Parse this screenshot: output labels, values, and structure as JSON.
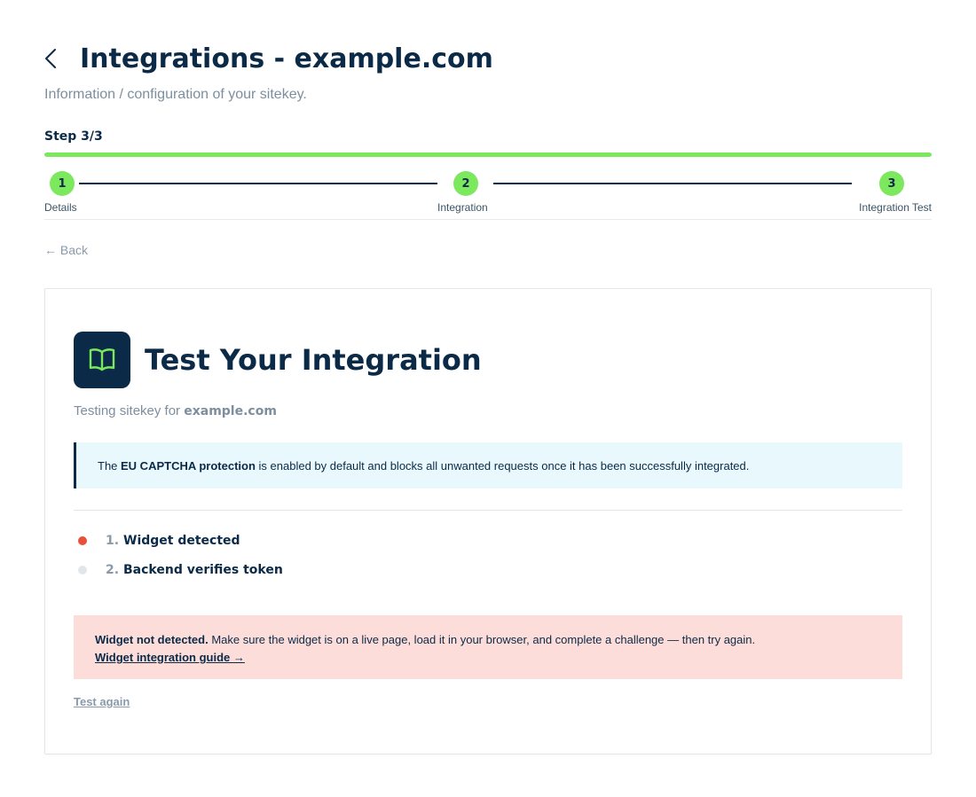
{
  "header": {
    "title": "Integrations - example.com",
    "subtitle": "Information / configuration of your sitekey."
  },
  "progress": {
    "label": "Step 3/3",
    "fraction": 1.0,
    "fill_color": "#7ce85e"
  },
  "stepper": {
    "steps": [
      {
        "number": "1",
        "label": "Details"
      },
      {
        "number": "2",
        "label": "Integration"
      },
      {
        "number": "3",
        "label": "Integration Test"
      }
    ]
  },
  "nav": {
    "back_label": "← Back"
  },
  "card": {
    "icon": "book-icon",
    "title": "Test Your Integration",
    "testing_prefix": "Testing sitekey for ",
    "testing_domain": "example.com",
    "info": {
      "prefix": "The ",
      "bold": "EU CAPTCHA protection",
      "suffix": " is enabled by default and blocks all unwanted requests once it has been successfully integrated."
    },
    "checks": [
      {
        "number": "1.",
        "label": "Widget detected",
        "status": "failed",
        "dot_color": "#e8503a"
      },
      {
        "number": "2.",
        "label": "Backend verifies token",
        "status": "pending",
        "dot_color": "#e3e6e9"
      }
    ],
    "error": {
      "bold": "Widget not detected.",
      "message": " Make sure the widget is on a live page, load it in your browser, and complete a challenge — then try again.",
      "link": "Widget integration guide →"
    },
    "test_again_label": "Test again"
  },
  "colors": {
    "primary": "#0b2a47",
    "accent_green": "#7ce85e",
    "error_bg": "#fdddda",
    "info_bg": "#e8f8fc"
  }
}
